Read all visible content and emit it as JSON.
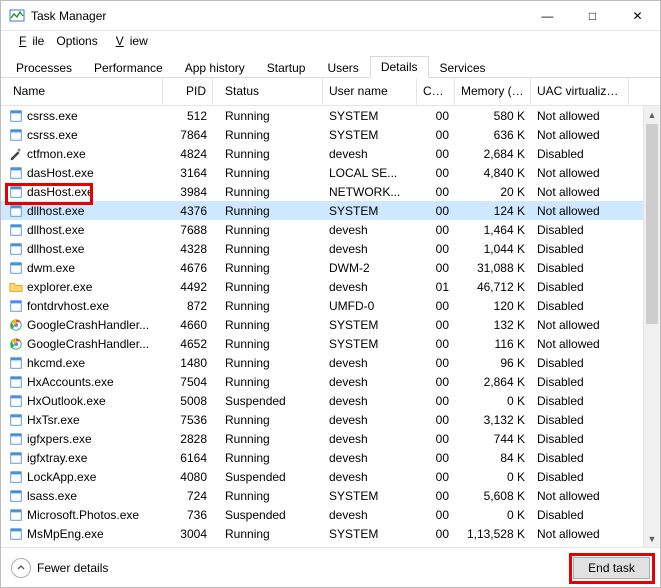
{
  "window": {
    "title": "Task Manager"
  },
  "menu": {
    "file": "File",
    "options": "Options",
    "view": "View"
  },
  "tabs": {
    "processes": "Processes",
    "performance": "Performance",
    "app_history": "App history",
    "startup": "Startup",
    "users": "Users",
    "details": "Details",
    "services": "Services"
  },
  "columns": {
    "name": "Name",
    "pid": "PID",
    "status": "Status",
    "user": "User name",
    "cpu": "CPU",
    "memory": "Memory (a...",
    "uac": "UAC virtualizat..."
  },
  "rows": [
    {
      "icon": "generic",
      "name": "csrss.exe",
      "pid": "512",
      "status": "Running",
      "user": "SYSTEM",
      "cpu": "00",
      "mem": "580 K",
      "uac": "Not allowed"
    },
    {
      "icon": "generic",
      "name": "csrss.exe",
      "pid": "7864",
      "status": "Running",
      "user": "SYSTEM",
      "cpu": "00",
      "mem": "636 K",
      "uac": "Not allowed"
    },
    {
      "icon": "pen",
      "name": "ctfmon.exe",
      "pid": "4824",
      "status": "Running",
      "user": "devesh",
      "cpu": "00",
      "mem": "2,684 K",
      "uac": "Disabled"
    },
    {
      "icon": "generic",
      "name": "dasHost.exe",
      "pid": "3164",
      "status": "Running",
      "user": "LOCAL SE...",
      "cpu": "00",
      "mem": "4,840 K",
      "uac": "Not allowed"
    },
    {
      "icon": "generic",
      "name": "dasHost.exe",
      "pid": "3984",
      "status": "Running",
      "user": "NETWORK...",
      "cpu": "00",
      "mem": "20 K",
      "uac": "Not allowed"
    },
    {
      "icon": "generic",
      "name": "dllhost.exe",
      "pid": "4376",
      "status": "Running",
      "user": "SYSTEM",
      "cpu": "00",
      "mem": "124 K",
      "uac": "Not allowed",
      "selected": true
    },
    {
      "icon": "generic",
      "name": "dllhost.exe",
      "pid": "7688",
      "status": "Running",
      "user": "devesh",
      "cpu": "00",
      "mem": "1,464 K",
      "uac": "Disabled"
    },
    {
      "icon": "generic",
      "name": "dllhost.exe",
      "pid": "4328",
      "status": "Running",
      "user": "devesh",
      "cpu": "00",
      "mem": "1,044 K",
      "uac": "Disabled"
    },
    {
      "icon": "generic",
      "name": "dwm.exe",
      "pid": "4676",
      "status": "Running",
      "user": "DWM-2",
      "cpu": "00",
      "mem": "31,088 K",
      "uac": "Disabled"
    },
    {
      "icon": "folder",
      "name": "explorer.exe",
      "pid": "4492",
      "status": "Running",
      "user": "devesh",
      "cpu": "01",
      "mem": "46,712 K",
      "uac": "Disabled"
    },
    {
      "icon": "generic",
      "name": "fontdrvhost.exe",
      "pid": "872",
      "status": "Running",
      "user": "UMFD-0",
      "cpu": "00",
      "mem": "120 K",
      "uac": "Disabled"
    },
    {
      "icon": "google",
      "name": "GoogleCrashHandler...",
      "pid": "4660",
      "status": "Running",
      "user": "SYSTEM",
      "cpu": "00",
      "mem": "132 K",
      "uac": "Not allowed"
    },
    {
      "icon": "google",
      "name": "GoogleCrashHandler...",
      "pid": "4652",
      "status": "Running",
      "user": "SYSTEM",
      "cpu": "00",
      "mem": "116 K",
      "uac": "Not allowed"
    },
    {
      "icon": "generic",
      "name": "hkcmd.exe",
      "pid": "1480",
      "status": "Running",
      "user": "devesh",
      "cpu": "00",
      "mem": "96 K",
      "uac": "Disabled"
    },
    {
      "icon": "generic",
      "name": "HxAccounts.exe",
      "pid": "7504",
      "status": "Running",
      "user": "devesh",
      "cpu": "00",
      "mem": "2,864 K",
      "uac": "Disabled"
    },
    {
      "icon": "generic",
      "name": "HxOutlook.exe",
      "pid": "5008",
      "status": "Suspended",
      "user": "devesh",
      "cpu": "00",
      "mem": "0 K",
      "uac": "Disabled"
    },
    {
      "icon": "generic",
      "name": "HxTsr.exe",
      "pid": "7536",
      "status": "Running",
      "user": "devesh",
      "cpu": "00",
      "mem": "3,132 K",
      "uac": "Disabled"
    },
    {
      "icon": "generic",
      "name": "igfxpers.exe",
      "pid": "2828",
      "status": "Running",
      "user": "devesh",
      "cpu": "00",
      "mem": "744 K",
      "uac": "Disabled"
    },
    {
      "icon": "generic",
      "name": "igfxtray.exe",
      "pid": "6164",
      "status": "Running",
      "user": "devesh",
      "cpu": "00",
      "mem": "84 K",
      "uac": "Disabled"
    },
    {
      "icon": "generic",
      "name": "LockApp.exe",
      "pid": "4080",
      "status": "Suspended",
      "user": "devesh",
      "cpu": "00",
      "mem": "0 K",
      "uac": "Disabled"
    },
    {
      "icon": "generic",
      "name": "lsass.exe",
      "pid": "724",
      "status": "Running",
      "user": "SYSTEM",
      "cpu": "00",
      "mem": "5,608 K",
      "uac": "Not allowed"
    },
    {
      "icon": "generic",
      "name": "Microsoft.Photos.exe",
      "pid": "736",
      "status": "Suspended",
      "user": "devesh",
      "cpu": "00",
      "mem": "0 K",
      "uac": "Disabled"
    },
    {
      "icon": "generic",
      "name": "MsMpEng.exe",
      "pid": "3004",
      "status": "Running",
      "user": "SYSTEM",
      "cpu": "00",
      "mem": "1,13,528 K",
      "uac": "Not allowed"
    }
  ],
  "footer": {
    "fewer": "Fewer details",
    "end_task": "End task"
  },
  "icons": {
    "generic": "app-icon-generic",
    "pen": "app-icon-pen",
    "folder": "app-icon-folder",
    "google": "app-icon-google"
  }
}
